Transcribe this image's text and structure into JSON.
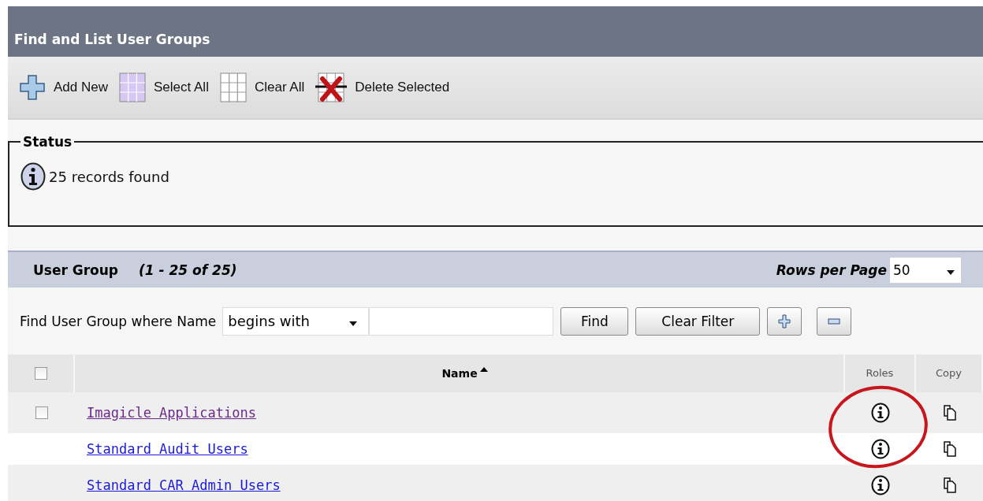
{
  "header": {
    "title": "Find and List User Groups"
  },
  "toolbar": [
    {
      "kind": "add",
      "label": "Add New"
    },
    {
      "kind": "select",
      "label": "Select All"
    },
    {
      "kind": "clear",
      "label": "Clear All"
    },
    {
      "kind": "delete",
      "label": "Delete Selected"
    }
  ],
  "status": {
    "legend": "Status",
    "message": "25 records found"
  },
  "section": {
    "title": "User Group",
    "range": "(1 - 25 of 25)",
    "rows_per_page_label": "Rows per Page",
    "rows_per_page": "50"
  },
  "filter": {
    "label": "Find User Group where Name",
    "operator": "begins with",
    "find": "Find",
    "clear": "Clear Filter"
  },
  "table": {
    "columns": [
      "Name",
      "Roles",
      "Copy"
    ],
    "sort_ascending": true,
    "header_checkbox": {
      "checked": false
    },
    "rows": [
      {
        "name": "Imagicle Applications",
        "visited": true,
        "checkbox": {
          "checked": false
        }
      },
      {
        "name": "Standard Audit Users",
        "visited": false
      },
      {
        "name": "Standard CAR Admin Users",
        "visited": false
      }
    ]
  },
  "annotation": {
    "kind": "circle"
  }
}
